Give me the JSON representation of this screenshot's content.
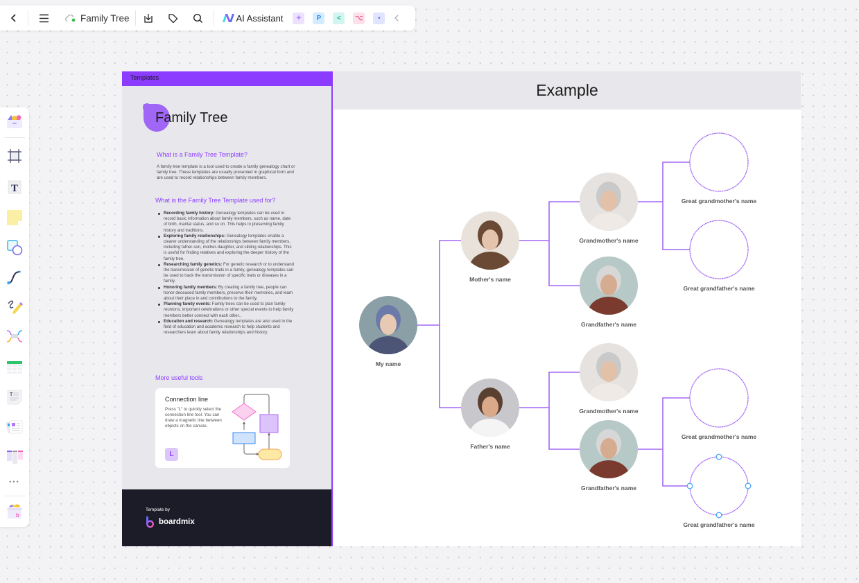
{
  "toolbar": {
    "back_icon": "chevron-left-icon",
    "menu_icon": "hamburger-menu-icon",
    "cloud_icon": "cloud-synced-icon",
    "document_title": "Family Tree",
    "download_icon": "download-icon",
    "tag_icon": "tag-icon",
    "search_icon": "search-icon",
    "ai_assistant_label": "AI Assistant",
    "apps": [
      {
        "name": "image-generator-app",
        "glyph": "✦",
        "bg": "#ece2fe",
        "fg": "#b48bf7"
      },
      {
        "name": "presentation-app",
        "glyph": "P",
        "bg": "#d4ecff",
        "fg": "#2e8ff0"
      },
      {
        "name": "mindmap-app",
        "glyph": "<",
        "bg": "#d2f6ef",
        "fg": "#12b89b"
      },
      {
        "name": "flowchart-app",
        "glyph": "⌥",
        "bg": "#fde0ea",
        "fg": "#ef5c8a"
      },
      {
        "name": "chat-app",
        "glyph": "▪",
        "bg": "#e0e4fe",
        "fg": "#6b78f0"
      }
    ],
    "collapse_icon": "chevron-left-icon"
  },
  "left_toolbar": {
    "items": [
      {
        "name": "templates-tool",
        "icon": "shapes-box-icon"
      },
      {
        "name": "frame-tool",
        "icon": "frame-icon"
      },
      {
        "name": "text-tool",
        "icon": "text-icon",
        "glyph": "T"
      },
      {
        "name": "sticky-note-tool",
        "icon": "sticky-note-icon"
      },
      {
        "name": "shape-tool",
        "icon": "shape-icon"
      },
      {
        "name": "connector-tool",
        "icon": "connector-line-icon"
      },
      {
        "name": "pen-tool",
        "icon": "pen-icon"
      },
      {
        "name": "mindmap-tool",
        "icon": "mindmap-icon"
      },
      {
        "name": "table-tool",
        "icon": "table-icon"
      },
      {
        "name": "text-document-tool",
        "icon": "document-icon"
      },
      {
        "name": "card-tool",
        "icon": "card-icon"
      },
      {
        "name": "kanban-tool",
        "icon": "kanban-icon"
      },
      {
        "name": "more-tools",
        "icon": "more-dots-icon",
        "glyph": "•••"
      },
      {
        "name": "apps-box-tool",
        "icon": "apps-box-icon"
      }
    ]
  },
  "template_panel": {
    "header": "Templates",
    "title": "Family Tree",
    "section1_heading": "What is a Family Tree Template?",
    "section1_body": "A family tree template is a tool used to create a family genealogy chart or family tree. These templates are usually presented in graphical form and are used to record relationships between family members.",
    "section2_heading": "What is the Family Tree Template used for?",
    "uses": [
      {
        "title": "Recording family history:",
        "text": " Genealogy templates can be used to record basic information about family members, such as name, date of birth, marital status, and so on. This helps in preserving family history and traditions."
      },
      {
        "title": "Exploring family relationships:",
        "text": " Genealogy templates enable a clearer understanding of the relationships between family members, including father-son, mother-daughter, and sibling relationships. This is useful for finding relatives and exploring the deeper history of the family tree."
      },
      {
        "title": "Researching family genetics:",
        "text": " For genetic research or to understand the transmission of genetic traits in a family, genealogy templates can be used to track the transmission of specific traits or diseases in a family."
      },
      {
        "title": "Honoring family members:",
        "text": " By creating a family tree, people can honor deceased family members, preserve their memories, and learn about their place in and contributions to the family."
      },
      {
        "title": "Planning family events:",
        "text": " Family trees can be used to plan family reunions, important celebrations or other special events to help family members better connect with each other.,"
      },
      {
        "title": "Education and research:",
        "text": " Genealogy templates are also used in the field of education and academic research to help students and researchers learn about family relationships and history."
      }
    ],
    "section3_heading": "More useful tools",
    "tool_card": {
      "title": "Connection line",
      "description": "Press \"L\" to quickly select the connection line tool. You can draw a magnetic line between objects on the canvas.",
      "shortcut_key": "L"
    },
    "footer": {
      "template_by": "Template by",
      "brand": "boardmix"
    }
  },
  "example": {
    "title": "Example",
    "line_color": "#a366f5",
    "people": [
      {
        "id": "me",
        "label": "My name",
        "photo": "child-photo"
      },
      {
        "id": "mother",
        "label": "Mother's name",
        "photo": "mother-photo"
      },
      {
        "id": "father",
        "label": "Father's name",
        "photo": "father-photo"
      },
      {
        "id": "m_grandmother",
        "label": "Grandmother's name",
        "photo": "grandmother-photo"
      },
      {
        "id": "m_grandfather",
        "label": "Grandfather's name",
        "photo": "grandfather-photo"
      },
      {
        "id": "p_grandmother",
        "label": "Grandmother's name",
        "photo": "grandmother-photo"
      },
      {
        "id": "p_grandfather",
        "label": "Grandfather's name",
        "photo": "grandfather-photo"
      },
      {
        "id": "ggm1",
        "label": "Great grandmother's name",
        "photo": "empty"
      },
      {
        "id": "ggf1",
        "label": "Great grandfather's name",
        "photo": "empty"
      },
      {
        "id": "ggm2",
        "label": "Great grandmother's name",
        "photo": "empty"
      },
      {
        "id": "ggf2",
        "label": "Great grandfather's name",
        "photo": "empty",
        "selected": true
      }
    ]
  }
}
